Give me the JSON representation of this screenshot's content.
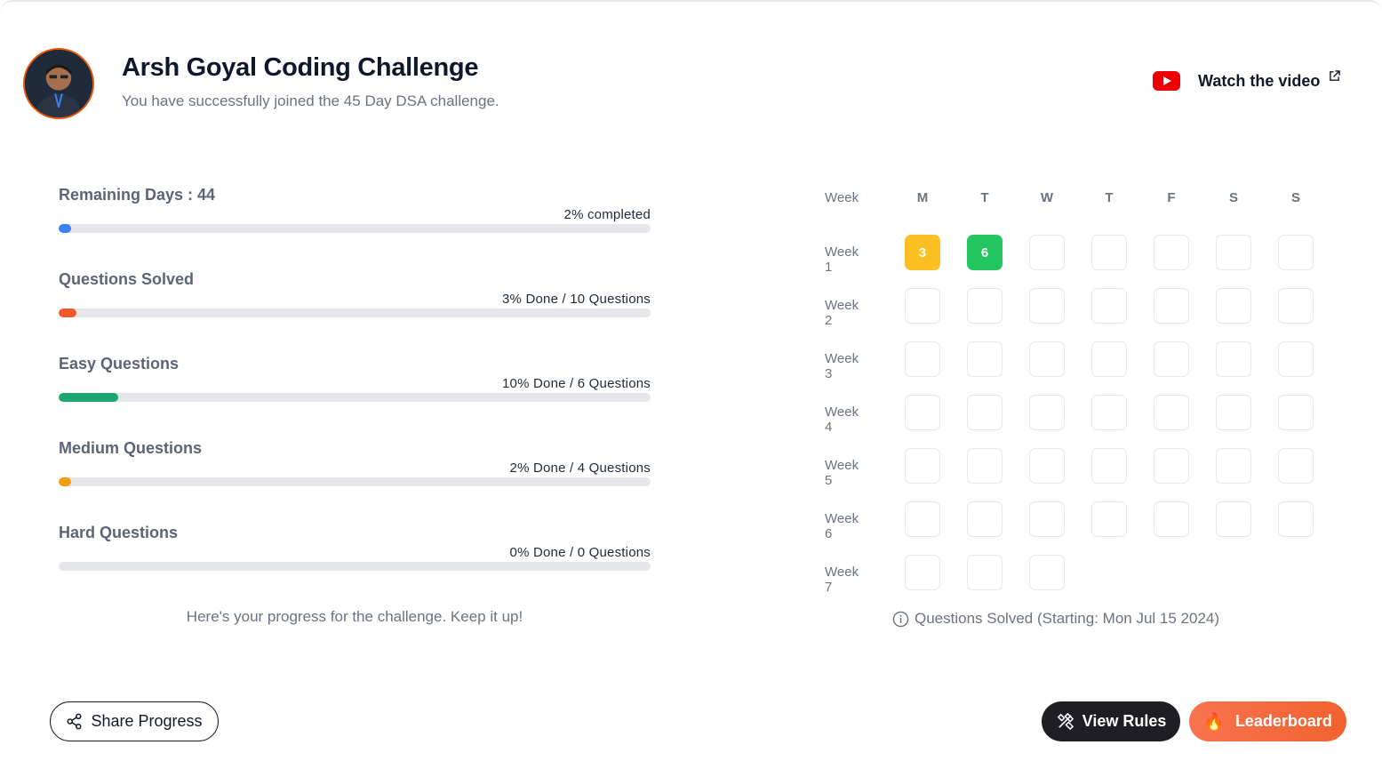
{
  "header": {
    "title": "Arsh Goyal Coding Challenge",
    "subtitle": "You have successfully joined the 45 Day DSA challenge.",
    "watch_label": "Watch the video"
  },
  "progress": {
    "remaining_days": "Remaining Days : 44",
    "remaining_days_value": 44,
    "items": [
      {
        "label": "Remaining Days : 44",
        "right": "2% completed",
        "percent": 2,
        "color": "#3b82f6"
      },
      {
        "label": "Questions Solved",
        "right": "3% Done / 10 Questions",
        "percent": 3,
        "color": "#f05a2c"
      },
      {
        "label": "Easy Questions",
        "right": "10% Done / 6 Questions",
        "percent": 10,
        "color": "#1ea672"
      },
      {
        "label": "Medium Questions",
        "right": "2% Done / 4 Questions",
        "percent": 2,
        "color": "#f59e0b"
      },
      {
        "label": "Hard Questions",
        "right": "0% Done / 0 Questions",
        "percent": 0,
        "color": "#9ca3af"
      }
    ],
    "note": "Here's your progress for the challenge. Keep it up!"
  },
  "calendar": {
    "week_header": "Week",
    "days": [
      "M",
      "T",
      "W",
      "T",
      "F",
      "S",
      "S"
    ],
    "weeks": [
      {
        "label": "Week 1",
        "cells": [
          3,
          6,
          null,
          null,
          null,
          null,
          null
        ]
      },
      {
        "label": "Week 2",
        "cells": [
          null,
          null,
          null,
          null,
          null,
          null,
          null
        ]
      },
      {
        "label": "Week 3",
        "cells": [
          null,
          null,
          null,
          null,
          null,
          null,
          null
        ]
      },
      {
        "label": "Week 4",
        "cells": [
          null,
          null,
          null,
          null,
          null,
          null,
          null
        ]
      },
      {
        "label": "Week 5",
        "cells": [
          null,
          null,
          null,
          null,
          null,
          null,
          null
        ]
      },
      {
        "label": "Week 6",
        "cells": [
          null,
          null,
          null,
          null,
          null,
          null,
          null
        ]
      },
      {
        "label": "Week 7",
        "cells": [
          null,
          null,
          null
        ]
      }
    ],
    "cell_colors": {
      "3": "#fbbf24",
      "6": "#22c55e"
    },
    "note": "Questions Solved (Starting: Mon Jul 15 2024)"
  },
  "buttons": {
    "share": "Share Progress",
    "rules": "View Rules",
    "leaderboard": "Leaderboard"
  },
  "icons": {
    "youtube": "youtube-icon",
    "external": "external-link-icon",
    "info": "info-icon",
    "share": "share-icon",
    "rules": "tools-icon",
    "leaderboard": "flame-icon"
  }
}
